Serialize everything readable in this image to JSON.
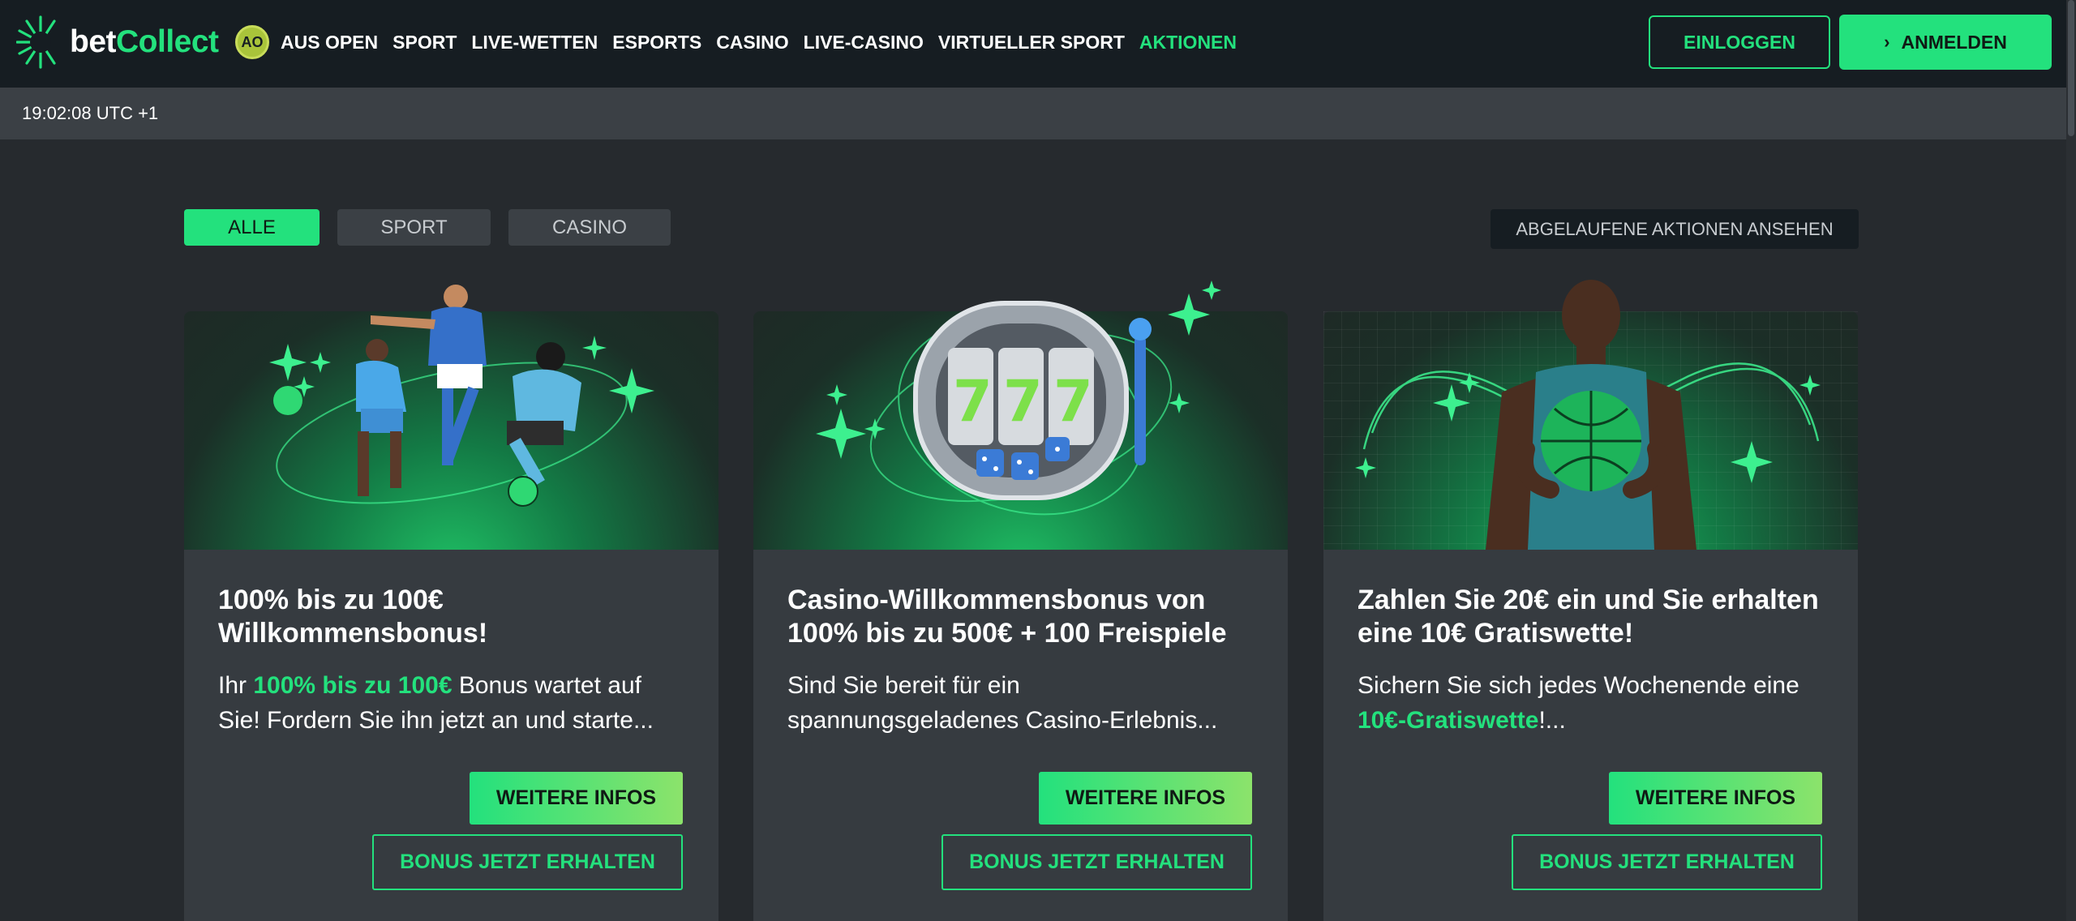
{
  "brand": {
    "name_part1": "bet",
    "name_part2": "Collect",
    "accent": "#23e17d"
  },
  "nav": {
    "ao_badge": "AO",
    "items": [
      "AUS OPEN",
      "SPORT",
      "LIVE-WETTEN",
      "ESPORTS",
      "CASINO",
      "LIVE-CASINO",
      "VIRTUELLER SPORT",
      "AKTIONEN"
    ],
    "active_index": 7
  },
  "auth": {
    "login_label": "EINLOGGEN",
    "register_label": "ANMELDEN"
  },
  "timebar": {
    "time": "19:02:08 UTC +1"
  },
  "filters": {
    "tabs": [
      "ALLE",
      "SPORT",
      "CASINO"
    ],
    "active_index": 0,
    "expired_label": "ABGELAUFENE AKTIONEN ANSEHEN"
  },
  "cards": [
    {
      "image_icon": "soccer-players-icon",
      "title": "100% bis zu 100€ Willkommensbonus!",
      "text_before": "Ihr ",
      "text_highlight": "100% bis zu 100€",
      "text_after": " Bonus wartet auf Sie! Fordern Sie ihn jetzt an und starte...",
      "more_label": "WEITERE INFOS",
      "bonus_label": "BONUS JETZT ERHALTEN"
    },
    {
      "image_icon": "slot-machine-icon",
      "title": "Casino-Willkommensbonus von 100% bis zu 500€ + 100 Freispiele",
      "text_before": "Sind Sie bereit für ein spannungsgeladenes Casino-Erlebnis...",
      "text_highlight": "",
      "text_after": "",
      "more_label": "WEITERE INFOS",
      "bonus_label": "BONUS JETZT ERHALTEN"
    },
    {
      "image_icon": "basketball-player-icon",
      "title": "Zahlen Sie 20€ ein und Sie erhalten eine 10€ Gratiswette!",
      "text_before": "Sichern Sie sich jedes Wochenende eine ",
      "text_highlight": "10€-Gratiswette",
      "text_after": "!...",
      "more_label": "WEITERE INFOS",
      "bonus_label": "BONUS JETZT ERHALTEN"
    }
  ]
}
